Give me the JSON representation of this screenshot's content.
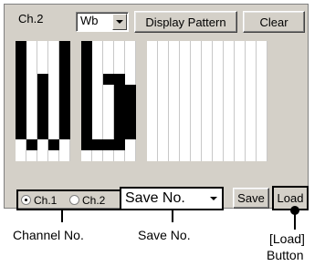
{
  "window": {
    "channel_label": "Ch.2",
    "pattern_select": {
      "value": "Wb"
    },
    "display_pattern_label": "Display Pattern",
    "clear_label": "Clear"
  },
  "pattern_grid": {
    "columns": 23,
    "rows": 11,
    "lit_cells": [
      [
        0,
        0
      ],
      [
        0,
        1
      ],
      [
        0,
        2
      ],
      [
        0,
        3
      ],
      [
        0,
        4
      ],
      [
        0,
        5
      ],
      [
        0,
        6
      ],
      [
        0,
        7
      ],
      [
        0,
        8
      ],
      [
        1,
        9
      ],
      [
        2,
        8
      ],
      [
        2,
        7
      ],
      [
        2,
        6
      ],
      [
        2,
        5
      ],
      [
        2,
        4
      ],
      [
        2,
        3
      ],
      [
        3,
        9
      ],
      [
        4,
        0
      ],
      [
        4,
        1
      ],
      [
        4,
        2
      ],
      [
        4,
        3
      ],
      [
        4,
        4
      ],
      [
        4,
        5
      ],
      [
        4,
        6
      ],
      [
        4,
        7
      ],
      [
        4,
        8
      ],
      [
        6,
        0
      ],
      [
        6,
        1
      ],
      [
        6,
        2
      ],
      [
        6,
        3
      ],
      [
        6,
        4
      ],
      [
        6,
        5
      ],
      [
        6,
        6
      ],
      [
        6,
        7
      ],
      [
        6,
        8
      ],
      [
        6,
        9
      ],
      [
        7,
        9
      ],
      [
        8,
        9
      ],
      [
        8,
        3
      ],
      [
        9,
        9
      ],
      [
        9,
        3
      ],
      [
        9,
        4
      ],
      [
        9,
        5
      ],
      [
        9,
        6
      ],
      [
        9,
        7
      ],
      [
        9,
        8
      ],
      [
        10,
        4
      ],
      [
        10,
        5
      ],
      [
        10,
        6
      ],
      [
        10,
        7
      ],
      [
        10,
        8
      ]
    ]
  },
  "bottom_bar": {
    "radio_ch1_label": "Ch.1",
    "radio_ch2_label": "Ch.2",
    "save_no_select": {
      "value": "Save No."
    },
    "save_label": "Save",
    "load_label": "Load"
  },
  "callouts": {
    "channel_no": "Channel No.",
    "save_no": "Save No.",
    "load_button_line1": "[Load]",
    "load_button_line2": "Button"
  }
}
